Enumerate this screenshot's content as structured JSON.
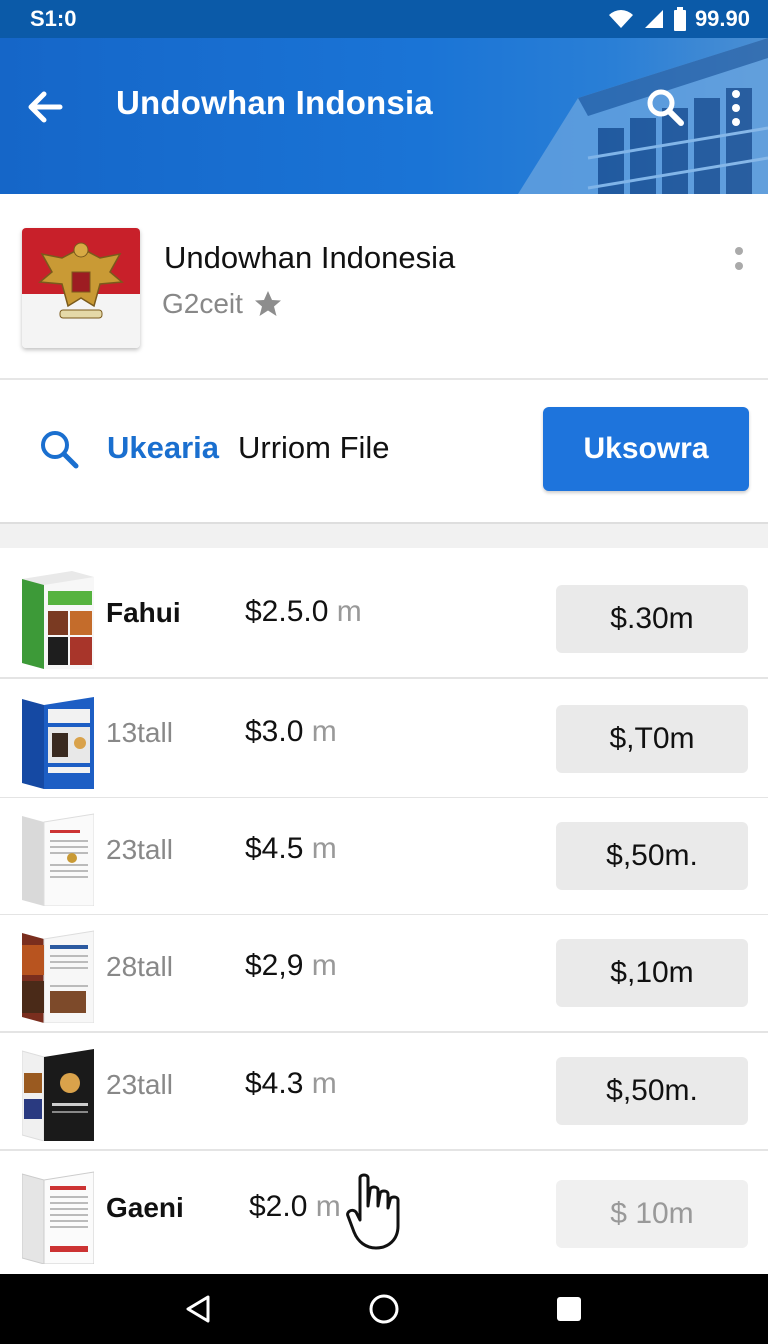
{
  "status": {
    "time": "S1:0",
    "battery_text": "99.90"
  },
  "app_bar": {
    "title": "Undowhan Indonsia"
  },
  "app_card": {
    "name": "Undowhan Indonesia",
    "subtitle": "G2ceit"
  },
  "toolbar": {
    "search_label": "Ukearia",
    "file_label": "Urriom File",
    "primary_button": "Uksowra"
  },
  "items": [
    {
      "name": "Fahui",
      "bold": true,
      "price": "$2.5.0",
      "price_unit": "m",
      "action": "$.30m"
    },
    {
      "name": "13tall",
      "bold": false,
      "price": "$3.0",
      "price_unit": "m",
      "action": "$,T0m"
    },
    {
      "name": "23tall",
      "bold": false,
      "price": "$4.5",
      "price_unit": "m",
      "action": "$,50m."
    },
    {
      "name": "28tall",
      "bold": false,
      "price": "$2,9",
      "price_unit": "m",
      "action": "$,10m"
    },
    {
      "name": "23tall",
      "bold": false,
      "price": "$4.3",
      "price_unit": "m",
      "action": "$,50m."
    },
    {
      "name": "Gaeni",
      "bold": true,
      "price": "$2.0",
      "price_unit": "m",
      "action": "$ 10m"
    }
  ],
  "icons": {
    "back": "arrow-left-icon",
    "search": "search-icon",
    "more": "more-vert-icon",
    "star": "star-icon",
    "cursor": "hand-pointer-icon"
  },
  "colors": {
    "app_bar": "#1a6fd0",
    "primary_button": "#1e74dc",
    "accent_text": "#1a6fcf"
  }
}
